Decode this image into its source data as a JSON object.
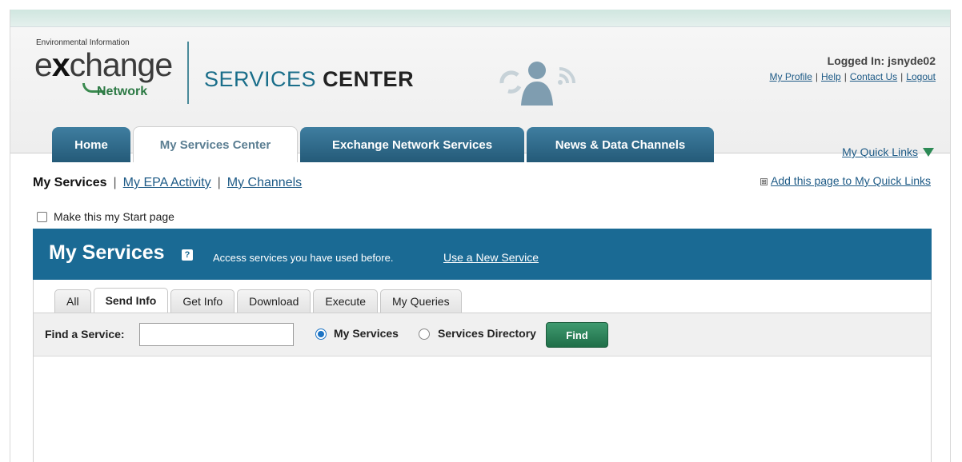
{
  "header": {
    "logo": {
      "env_text": "Environmental Information",
      "word": "change",
      "word_x": "x",
      "word_e": "e",
      "network": "Network"
    },
    "title_normal": "SERVICES ",
    "title_bold": "CENTER",
    "user": {
      "logged_in": "Logged In: jsnyde02",
      "links": [
        "My Profile",
        "Help",
        "Contact Us",
        "Logout"
      ],
      "separator": "|"
    },
    "quick_links": "My Quick Links"
  },
  "main_tabs": [
    {
      "label": "Home"
    },
    {
      "label": "My Services Center"
    },
    {
      "label": "Exchange Network Services"
    },
    {
      "label": "News & Data Channels"
    }
  ],
  "subnav": {
    "current": "My Services",
    "links": [
      "My EPA Activity",
      "My Channels"
    ],
    "separator": "|",
    "add_quick": "Add this page to My Quick Links",
    "add_quick_icon": "⊞",
    "start_page_label": "Make this my Start page"
  },
  "services": {
    "title": "My Services",
    "help_icon": "?",
    "description": "Access services you have used before.",
    "new_service_link": "Use a New Service",
    "tabs": [
      "All",
      "Send Info",
      "Get Info",
      "Download",
      "Execute",
      "My Queries"
    ],
    "find": {
      "label": "Find a Service:",
      "value": "",
      "options": [
        "My Services",
        "Services Directory"
      ],
      "selected": "My Services",
      "button": "Find"
    }
  },
  "colors": {
    "accent_blue": "#1a6a94",
    "tab_blue": "#245a78",
    "link_blue": "#1d5a86",
    "find_green": "#2c8a55"
  }
}
